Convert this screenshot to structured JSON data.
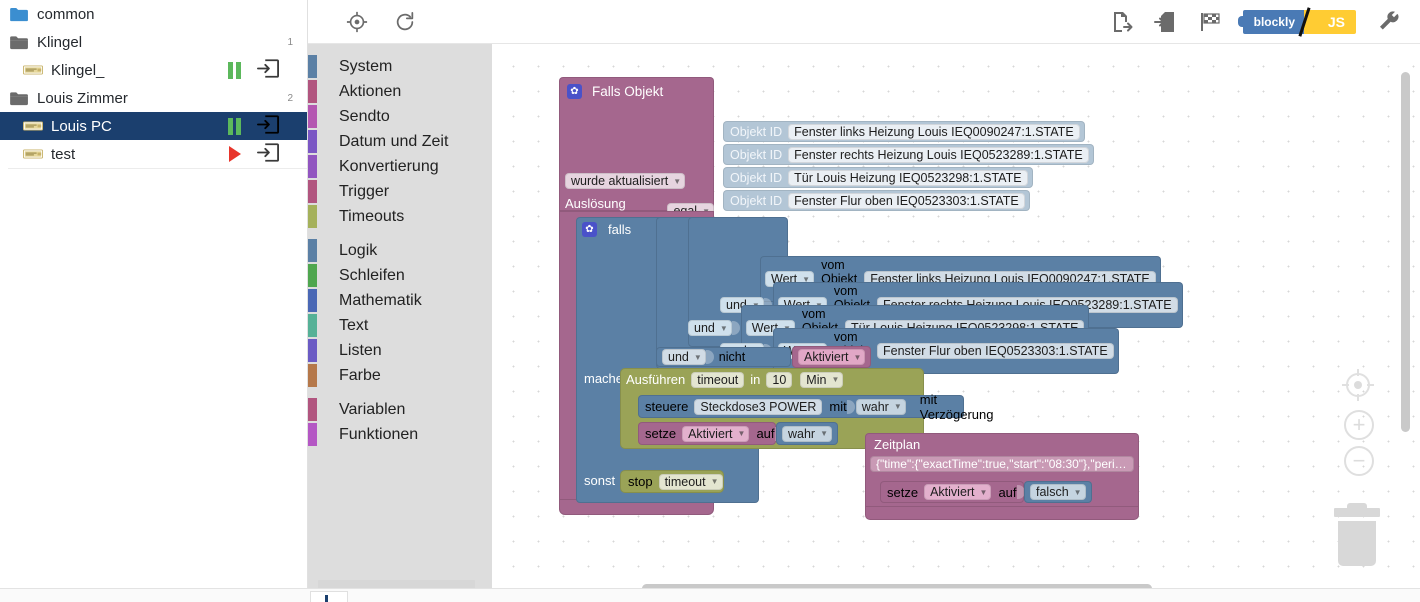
{
  "sidebar": {
    "items": [
      {
        "label": "common",
        "icon": "folder-open-blue-icon",
        "depth": 0,
        "count": "",
        "state": "",
        "selected": false,
        "has_enter": false
      },
      {
        "label": "Klingel",
        "icon": "folder-gray-icon",
        "depth": 0,
        "count": "1",
        "state": "",
        "selected": false,
        "has_enter": false
      },
      {
        "label": "Klingel_",
        "icon": "script-icon",
        "depth": 1,
        "count": "",
        "state": "pause",
        "selected": false,
        "has_enter": true
      },
      {
        "label": "Louis Zimmer",
        "icon": "folder-gray-icon",
        "depth": 0,
        "count": "2",
        "state": "",
        "selected": false,
        "has_enter": false
      },
      {
        "label": "Louis PC",
        "icon": "script-icon",
        "depth": 1,
        "count": "",
        "state": "pause",
        "selected": true,
        "has_enter": true
      },
      {
        "label": "test",
        "icon": "script-icon",
        "depth": 1,
        "count": "",
        "state": "play",
        "selected": false,
        "has_enter": true
      }
    ]
  },
  "toolbar": {
    "left_buttons": [
      {
        "name": "center-target-icon",
        "glyph": "◉"
      },
      {
        "name": "reload-icon",
        "glyph": "⟳"
      }
    ],
    "right_buttons": [
      {
        "name": "export-blocks-icon",
        "glyph": "export"
      },
      {
        "name": "import-blocks-icon",
        "glyph": "import"
      },
      {
        "name": "checkered-flag-icon",
        "glyph": "flag"
      },
      {
        "name": "wrench-icon",
        "glyph": "wrench"
      }
    ],
    "mode_toggle": {
      "blockly_label": "blockly",
      "js_label": "JS",
      "blockly_color": "#4a7ab5",
      "js_color": "#ffcc33"
    }
  },
  "toolbox": {
    "groups": [
      {
        "items": [
          {
            "label": "System",
            "color": "#5b80a5"
          },
          {
            "label": "Aktionen",
            "color": "#b1557f"
          },
          {
            "label": "Sendto",
            "color": "#b457b1"
          },
          {
            "label": "Datum und Zeit",
            "color": "#7b57c4"
          },
          {
            "label": "Konvertierung",
            "color": "#9155c0"
          },
          {
            "label": "Trigger",
            "color": "#b1557f"
          },
          {
            "label": "Timeouts",
            "color": "#a5b15b"
          }
        ]
      },
      {
        "items": [
          {
            "label": "Logik",
            "color": "#5b80a5"
          },
          {
            "label": "Schleifen",
            "color": "#4fa64f"
          },
          {
            "label": "Mathematik",
            "color": "#4a68b5"
          },
          {
            "label": "Text",
            "color": "#56b197"
          },
          {
            "label": "Listen",
            "color": "#6b5bc4"
          },
          {
            "label": "Farbe",
            "color": "#b5784a"
          }
        ]
      },
      {
        "items": [
          {
            "label": "Variablen",
            "color": "#b1557f"
          },
          {
            "label": "Funktionen",
            "color": "#b457c4"
          }
        ]
      }
    ]
  },
  "workspace": {
    "trigger_block": {
      "title": "Falls Objekt",
      "object_id_label": "Objekt ID",
      "object_ids": [
        "Fenster links Heizung Louis IEQ0090247:1.STATE",
        "Fenster rechts Heizung Louis  IEQ0523289:1.STATE",
        "Tür Louis Heizung IEQ0523298:1.STATE",
        "Fenster Flur oben IEQ0523303:1.STATE"
      ],
      "condition_dropdown": "wurde aktualisiert",
      "trigger_by_label": "Auslösung durch",
      "trigger_by_value": "egal",
      "color": "#a5678e"
    },
    "if_block": {
      "if_label": "falls",
      "do_label": "mache",
      "else_label": "sonst",
      "color": "#5b80a5",
      "conditions": [
        {
          "join": "",
          "value_label": "Wert",
          "of_label": "vom Objekt ID",
          "object_id": "Fenster links Heizung Louis IEQ0090247:1.STATE"
        },
        {
          "join": "und",
          "value_label": "Wert",
          "of_label": "vom Objekt ID",
          "object_id": "Fenster rechts Heizung Louis  IEQ0523289:1.STATE"
        },
        {
          "join": "und",
          "value_label": "Wert",
          "of_label": "vom Objekt ID",
          "object_id": "Tür Louis Heizung IEQ0523298:1.STATE"
        },
        {
          "join": "und",
          "value_label": "Wert",
          "of_label": "vom Objekt ID",
          "object_id": "Fenster Flur oben IEQ0523303:1.STATE"
        }
      ],
      "outer_join": "und",
      "not_label": "nicht",
      "not_variable": "Aktiviert"
    },
    "timeout_block": {
      "run_label": "Ausführen",
      "timeout_name": "timeout",
      "in_label": "in",
      "delay_value": "10",
      "delay_unit": "Min",
      "color": "#9aa357"
    },
    "control_block": {
      "control_label": "steuere",
      "object_id": "Steckdose3 POWER",
      "with_label": "mit",
      "value": "wahr",
      "delay_label": "mit Verzögerung",
      "color": "#5b80a5"
    },
    "set_block": {
      "set_label": "setze",
      "variable": "Aktiviert",
      "to_label": "auf",
      "value": "wahr",
      "color": "#a5678e"
    },
    "stop_block": {
      "stop_label": "stop",
      "timeout_name": "timeout",
      "color": "#9aa357"
    },
    "schedule_block": {
      "title": "Zeitplan",
      "cron": "{\"time\":{\"exactTime\":true,\"start\":\"08:30\"},\"peri…",
      "color": "#a5678e",
      "set_label": "setze",
      "variable": "Aktiviert",
      "to_label": "auf",
      "value": "falsch"
    },
    "zoom_controls": {
      "center": "center-target-icon",
      "zoom_in": "+",
      "zoom_out": "−",
      "trash": "trash-icon"
    }
  }
}
